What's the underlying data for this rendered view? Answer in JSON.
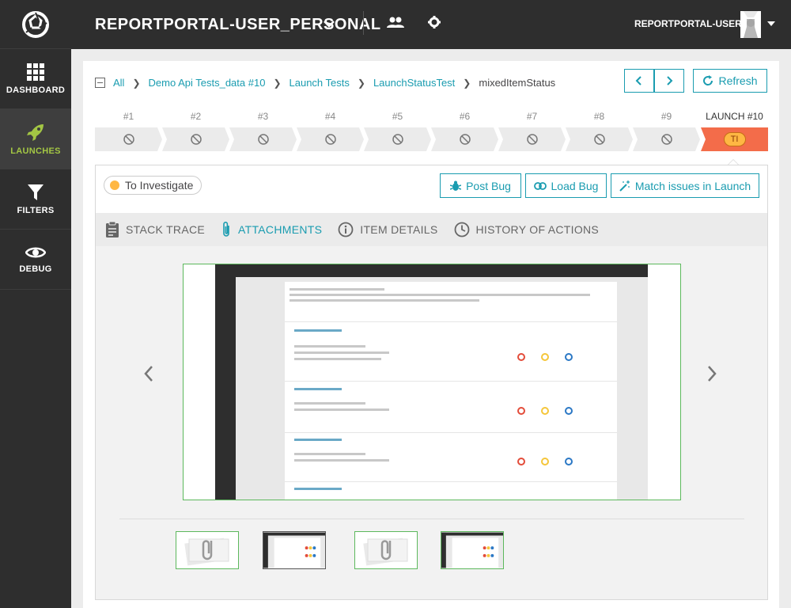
{
  "sidebar": {
    "items": [
      {
        "label": "DASHBOARD",
        "icon": "dashboard-grid-icon"
      },
      {
        "label": "LAUNCHES",
        "icon": "rocket-icon",
        "active": true
      },
      {
        "label": "FILTERS",
        "icon": "filter-funnel-icon"
      },
      {
        "label": "DEBUG",
        "icon": "eye-icon"
      }
    ]
  },
  "header": {
    "project": "REPORTPORTAL-USER_PERSONAL",
    "username": "REPORTPORTAL-USER"
  },
  "breadcrumb": {
    "items": [
      "All",
      "Demo Api Tests_data #10",
      "Launch Tests",
      "LaunchStatusTest"
    ],
    "current": "mixedItemStatus"
  },
  "toolbar": {
    "refresh_label": "Refresh"
  },
  "history": {
    "items": [
      "#1",
      "#2",
      "#3",
      "#4",
      "#5",
      "#6",
      "#7",
      "#8",
      "#9"
    ],
    "active_label": "LAUNCH #10",
    "active_badge": "TI"
  },
  "defect": {
    "label": "To Investigate",
    "color": "#ffb743"
  },
  "actions": {
    "post_bug": "Post Bug",
    "load_bug": "Load Bug",
    "match_issues": "Match issues in Launch"
  },
  "tabs": {
    "stack_trace": "STACK TRACE",
    "attachments": "ATTACHMENTS",
    "item_details": "ITEM DETAILS",
    "history_actions": "HISTORY OF ACTIONS"
  },
  "colors": {
    "accent": "#1a9cb0",
    "sidebar_active": "#a3c644",
    "failed": "#f36c4a",
    "to_investigate": "#ffb743"
  }
}
